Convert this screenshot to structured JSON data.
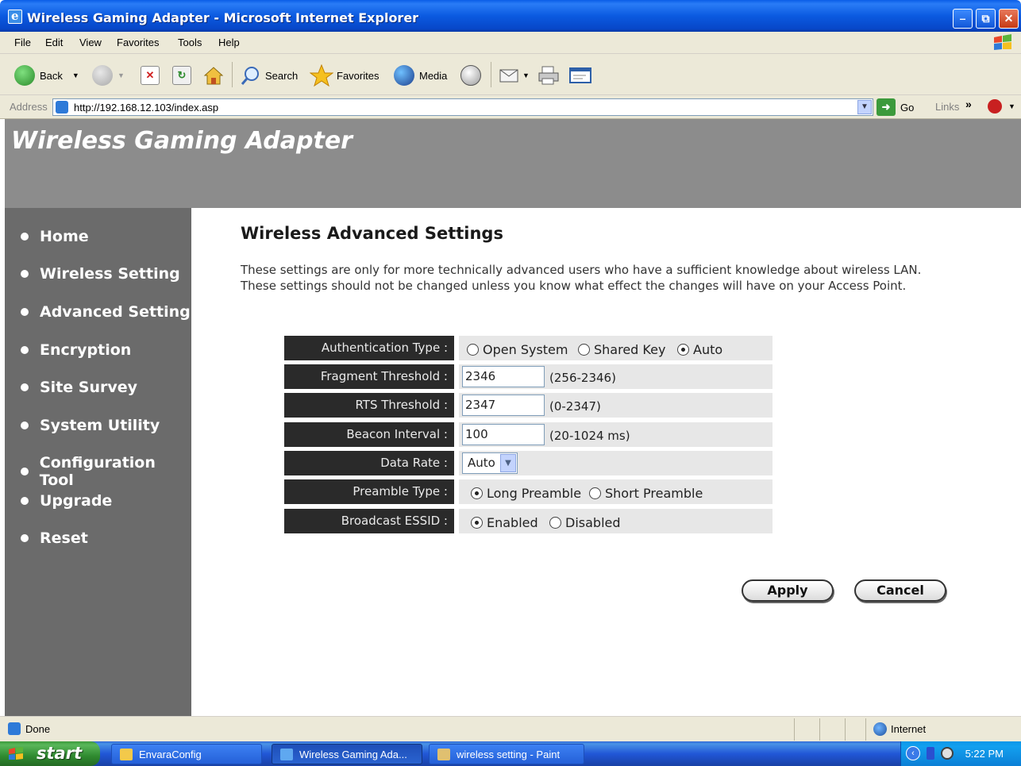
{
  "window": {
    "title": "Wireless Gaming Adapter - Microsoft Internet Explorer",
    "controls": [
      "minimize",
      "maximize",
      "close"
    ]
  },
  "menubar": {
    "items": [
      "File",
      "Edit",
      "View",
      "Favorites",
      "Tools",
      "Help"
    ]
  },
  "toolbar": {
    "back_label": "Back",
    "search_label": "Search",
    "favorites_label": "Favorites",
    "media_label": "Media"
  },
  "address": {
    "label": "Address",
    "url": "http://192.168.12.103/index.asp",
    "go_label": "Go",
    "links_label": "Links"
  },
  "page": {
    "brand": "Wireless Gaming Adapter",
    "nav": [
      "Home",
      "Wireless Setting",
      "Advanced Setting",
      "Encryption",
      "Site Survey",
      "System Utility",
      "Configuration Tool",
      "Upgrade",
      "Reset"
    ],
    "heading": "Wireless Advanced Settings",
    "description": "These settings are only for more technically advanced users who have a sufficient knowledge about wireless LAN. These settings should not be changed unless you know what effect the changes will have on your Access Point.",
    "settings": {
      "auth_type": {
        "label": "Authentication Type :",
        "options": [
          "Open System",
          "Shared Key",
          "Auto"
        ],
        "selected": "Auto"
      },
      "fragment": {
        "label": "Fragment Threshold :",
        "value": "2346",
        "range": "(256-2346)"
      },
      "rts": {
        "label": "RTS Threshold :",
        "value": "2347",
        "range": "(0-2347)"
      },
      "beacon": {
        "label": "Beacon Interval :",
        "value": "100",
        "range": "(20-1024 ms)"
      },
      "data_rate": {
        "label": "Data Rate :",
        "value": "Auto"
      },
      "preamble": {
        "label": "Preamble Type :",
        "options": [
          "Long Preamble",
          "Short Preamble"
        ],
        "selected": "Long Preamble"
      },
      "broadcast_essid": {
        "label": "Broadcast ESSID :",
        "options": [
          "Enabled",
          "Disabled"
        ],
        "selected": "Enabled"
      }
    },
    "apply_label": "Apply",
    "cancel_label": "Cancel"
  },
  "statusbar": {
    "status": "Done",
    "zone": "Internet"
  },
  "taskbar": {
    "start_label": "start",
    "tasks": [
      "EnvaraConfig",
      "Wireless Gaming Ada...",
      "wireless setting - Paint"
    ],
    "clock": "5:22 PM"
  },
  "colors": {
    "banner": "#8c8c8c",
    "sidebar": "#6b6b6b",
    "label_bg": "#2a2a2a",
    "value_bg": "#e7e7e7",
    "xp_blue": "#0b5ae0"
  }
}
